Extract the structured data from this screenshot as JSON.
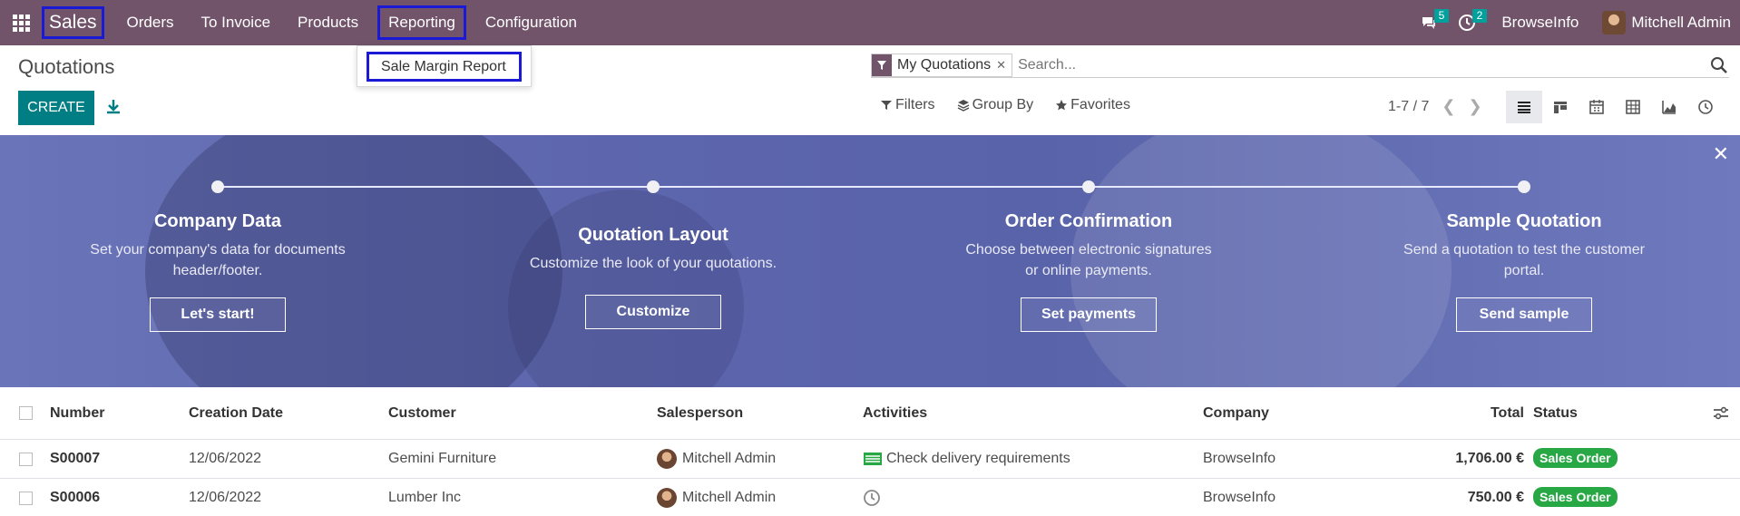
{
  "navbar": {
    "brand": "Sales",
    "menu": [
      "Orders",
      "To Invoice",
      "Products",
      "Reporting",
      "Configuration"
    ],
    "messages_count": "5",
    "activities_count": "2",
    "company": "BrowseInfo",
    "user": "Mitchell Admin",
    "color": "#71546a"
  },
  "reporting_dropdown": {
    "items": [
      "Sale Margin Report"
    ]
  },
  "control_panel": {
    "title": "Quotations",
    "create_label": "CREATE",
    "search": {
      "facet": "My Quotations",
      "placeholder": "Search..."
    },
    "filters_label": "Filters",
    "group_by_label": "Group By",
    "favorites_label": "Favorites",
    "pager": "1-7 / 7",
    "views": [
      "list-view-icon",
      "kanban-view-icon",
      "calendar-view-icon",
      "pivot-view-icon",
      "graph-view-icon",
      "activity-view-icon"
    ],
    "accent": "#017e84"
  },
  "banner": {
    "steps": [
      {
        "title": "Company Data",
        "text": "Set your company's data for documents header/footer.",
        "button": "Let's start!"
      },
      {
        "title": "Quotation Layout",
        "text": "Customize the look of your quotations.",
        "button": "Customize"
      },
      {
        "title": "Order Confirmation",
        "text": "Choose between electronic signatures or online payments.",
        "button": "Set payments"
      },
      {
        "title": "Sample Quotation",
        "text": "Send a quotation to test the customer portal.",
        "button": "Send sample"
      }
    ]
  },
  "table": {
    "headers": [
      "Number",
      "Creation Date",
      "Customer",
      "Salesperson",
      "Activities",
      "Company",
      "Total",
      "Status"
    ],
    "rows": [
      {
        "number": "S00007",
        "date": "12/06/2022",
        "customer": "Gemini Furniture",
        "salesperson": "Mitchell Admin",
        "activity": "Check delivery requirements",
        "company": "BrowseInfo",
        "total": "1,706.00 €",
        "status": "Sales Order"
      },
      {
        "number": "S00006",
        "date": "12/06/2022",
        "customer": "Lumber Inc",
        "salesperson": "Mitchell Admin",
        "activity": "",
        "company": "BrowseInfo",
        "total": "750.00 €",
        "status": "Sales Order"
      }
    ],
    "status_color": "#28a745"
  }
}
